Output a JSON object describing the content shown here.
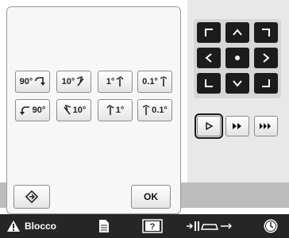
{
  "rotate": {
    "row1": [
      {
        "label": "90°",
        "icon": "rotate-right-90-icon"
      },
      {
        "label": "10°",
        "icon": "rotate-right-10-icon"
      },
      {
        "label": "1°",
        "icon": "rotate-right-1-icon"
      },
      {
        "label": "0.1°",
        "icon": "rotate-right-0-1-icon"
      }
    ],
    "row2": [
      {
        "label": "90°",
        "icon": "rotate-left-90-icon"
      },
      {
        "label": "10°",
        "icon": "rotate-left-10-icon"
      },
      {
        "label": "1°",
        "icon": "rotate-left-1-icon"
      },
      {
        "label": "0.1°",
        "icon": "rotate-left-0-1-icon"
      }
    ]
  },
  "dialog": {
    "ok_label": "OK",
    "reset_icon": "reset-rotation-icon"
  },
  "arrow_pad": {
    "icons": [
      "corner-top-left-icon",
      "arrow-up-icon",
      "corner-top-right-icon",
      "arrow-left-icon",
      "center-dot-icon",
      "arrow-right-icon",
      "corner-bottom-left-icon",
      "arrow-down-icon",
      "corner-bottom-right-icon"
    ]
  },
  "speed": {
    "icons": [
      "play-slow-icon",
      "play-medium-icon",
      "play-fast-icon"
    ],
    "selected": 0
  },
  "taskbar": {
    "blocco_label": "Blocco",
    "icons": [
      "warning-icon",
      "page-icon",
      "frame-help-icon",
      "presser-foot-icon",
      "clock-icon"
    ]
  },
  "colors": {
    "bar": "#262626",
    "pad": "#1c1c1c",
    "panel_border": "#9a9a9a"
  }
}
